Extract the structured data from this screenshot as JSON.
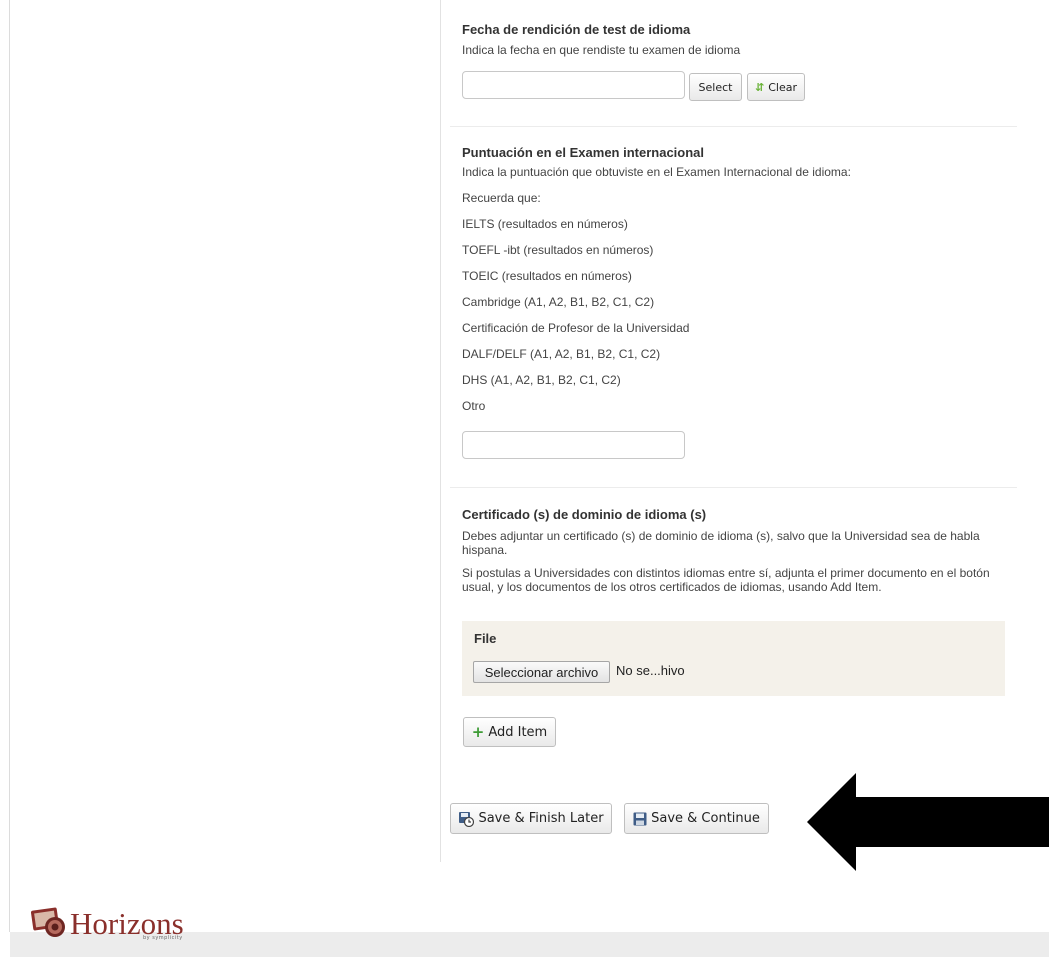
{
  "exam_date": {
    "title": "Fecha de rendición de test de idioma",
    "description": "Indica la fecha en que rendiste tu examen de idioma",
    "value": "",
    "select_label": "Select",
    "clear_label": "Clear"
  },
  "score": {
    "title": "Puntuación en el Examen internacional",
    "lines": [
      "Indica la puntuación que obtuviste en el Examen Internacional de idioma:",
      "Recuerda que:",
      "IELTS (resultados  en números)",
      "TOEFL -ibt (resultados en números)",
      "TOEIC (resultados en números)",
      "Cambridge  (A1, A2, B1, B2, C1, C2)",
      "Certificación de Profesor de la Universidad",
      "DALF/DELF (A1, A2, B1, B2, C1, C2)",
      "DHS (A1, A2, B1, B2, C1, C2)",
      "Otro"
    ],
    "value": ""
  },
  "certificate": {
    "title": "Certificado (s) de dominio de idioma (s)",
    "paragraph1": "Debes adjuntar un certificado (s) de dominio de idioma (s), salvo que la Universidad sea de habla hispana.",
    "paragraph2": "Si postulas a Universidades con distintos idiomas entre sí, adjunta el primer documento en el botón usual, y los documentos de los otros certificados de idiomas, usando Add Item.",
    "file_label": "File",
    "file_button": "Seleccionar archivo",
    "file_status": "No se...hivo",
    "add_item": "Add Item"
  },
  "actions": {
    "save_finish": "Save & Finish Later",
    "save_continue": "Save & Continue"
  },
  "footer": {
    "brand": "Horizons",
    "byline": "by symplicity"
  },
  "colors": {
    "footer_bg": "#ececec",
    "file_box_bg": "#f4f1ea",
    "brand": "#8a2f2b",
    "arrow": "#000000"
  }
}
